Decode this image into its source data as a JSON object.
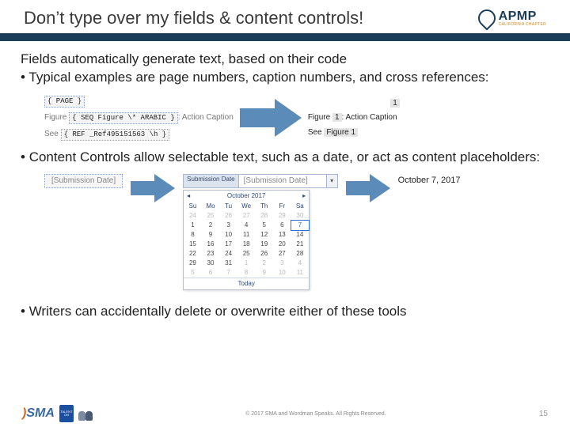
{
  "header": {
    "title": "Don’t type over my fields & content controls!",
    "logo": {
      "name": "APMP",
      "sub": "CALIFORNIA CHAPTER"
    }
  },
  "body": {
    "intro": "Fields automatically generate text, based on their code",
    "bullet1": "Typical examples are page numbers, caption numbers, and cross references:",
    "bullet2": "Content Controls allow selectable text, such as a date, or act as content placeholders:",
    "bullet3": "Writers can accidentally delete or overwrite either of these tools"
  },
  "fields_left": {
    "page_code": "{ PAGE }",
    "figure_label": "Figure",
    "figure_code": "{ SEQ Figure \\* ARABIC }",
    "figure_suffix": ": Action Caption",
    "see_label": "See",
    "ref_code": "{ REF _Ref495151563 \\h }"
  },
  "fields_right": {
    "page": "1",
    "figure": "Figure 1: Action Caption",
    "figure_num": "1",
    "see": "See Figure 1",
    "see_ref": "Figure 1"
  },
  "cc": {
    "placeholder": "[Submission Date]",
    "tab": "Submission Date",
    "field": "[Submission Date]",
    "dropdown_glyph": "▾",
    "result": "October 7, 2017"
  },
  "calendar": {
    "month": "October 2017",
    "nav_prev": "◂",
    "nav_next": "▸",
    "dow": [
      "Su",
      "Mo",
      "Tu",
      "We",
      "Th",
      "Fr",
      "Sa"
    ],
    "days": [
      {
        "n": 24,
        "dim": true
      },
      {
        "n": 25,
        "dim": true
      },
      {
        "n": 26,
        "dim": true
      },
      {
        "n": 27,
        "dim": true
      },
      {
        "n": 28,
        "dim": true
      },
      {
        "n": 29,
        "dim": true
      },
      {
        "n": 30,
        "dim": true
      },
      {
        "n": 1
      },
      {
        "n": 2
      },
      {
        "n": 3
      },
      {
        "n": 4
      },
      {
        "n": 5
      },
      {
        "n": 6
      },
      {
        "n": 7,
        "sel": true
      },
      {
        "n": 8
      },
      {
        "n": 9
      },
      {
        "n": 10
      },
      {
        "n": 11
      },
      {
        "n": 12
      },
      {
        "n": 13
      },
      {
        "n": 14
      },
      {
        "n": 15
      },
      {
        "n": 16
      },
      {
        "n": 17
      },
      {
        "n": 18
      },
      {
        "n": 19
      },
      {
        "n": 20
      },
      {
        "n": 21
      },
      {
        "n": 22
      },
      {
        "n": 23
      },
      {
        "n": 24
      },
      {
        "n": 25
      },
      {
        "n": 26
      },
      {
        "n": 27
      },
      {
        "n": 28
      },
      {
        "n": 29
      },
      {
        "n": 30
      },
      {
        "n": 31
      },
      {
        "n": 1,
        "dim": true
      },
      {
        "n": 2,
        "dim": true
      },
      {
        "n": 3,
        "dim": true
      },
      {
        "n": 4,
        "dim": true
      },
      {
        "n": 5,
        "dim": true
      },
      {
        "n": 6,
        "dim": true
      },
      {
        "n": 7,
        "dim": true
      },
      {
        "n": 8,
        "dim": true
      },
      {
        "n": 9,
        "dim": true
      },
      {
        "n": 10,
        "dim": true
      },
      {
        "n": 11,
        "dim": true
      }
    ],
    "today": "Today"
  },
  "footer": {
    "sma": "SMA",
    "badge_top": "TALENT",
    "badge_bot": "ON",
    "copyright": "© 2017 SMA and Wordman Speaks. All Rights Reserved.",
    "page": "15"
  }
}
